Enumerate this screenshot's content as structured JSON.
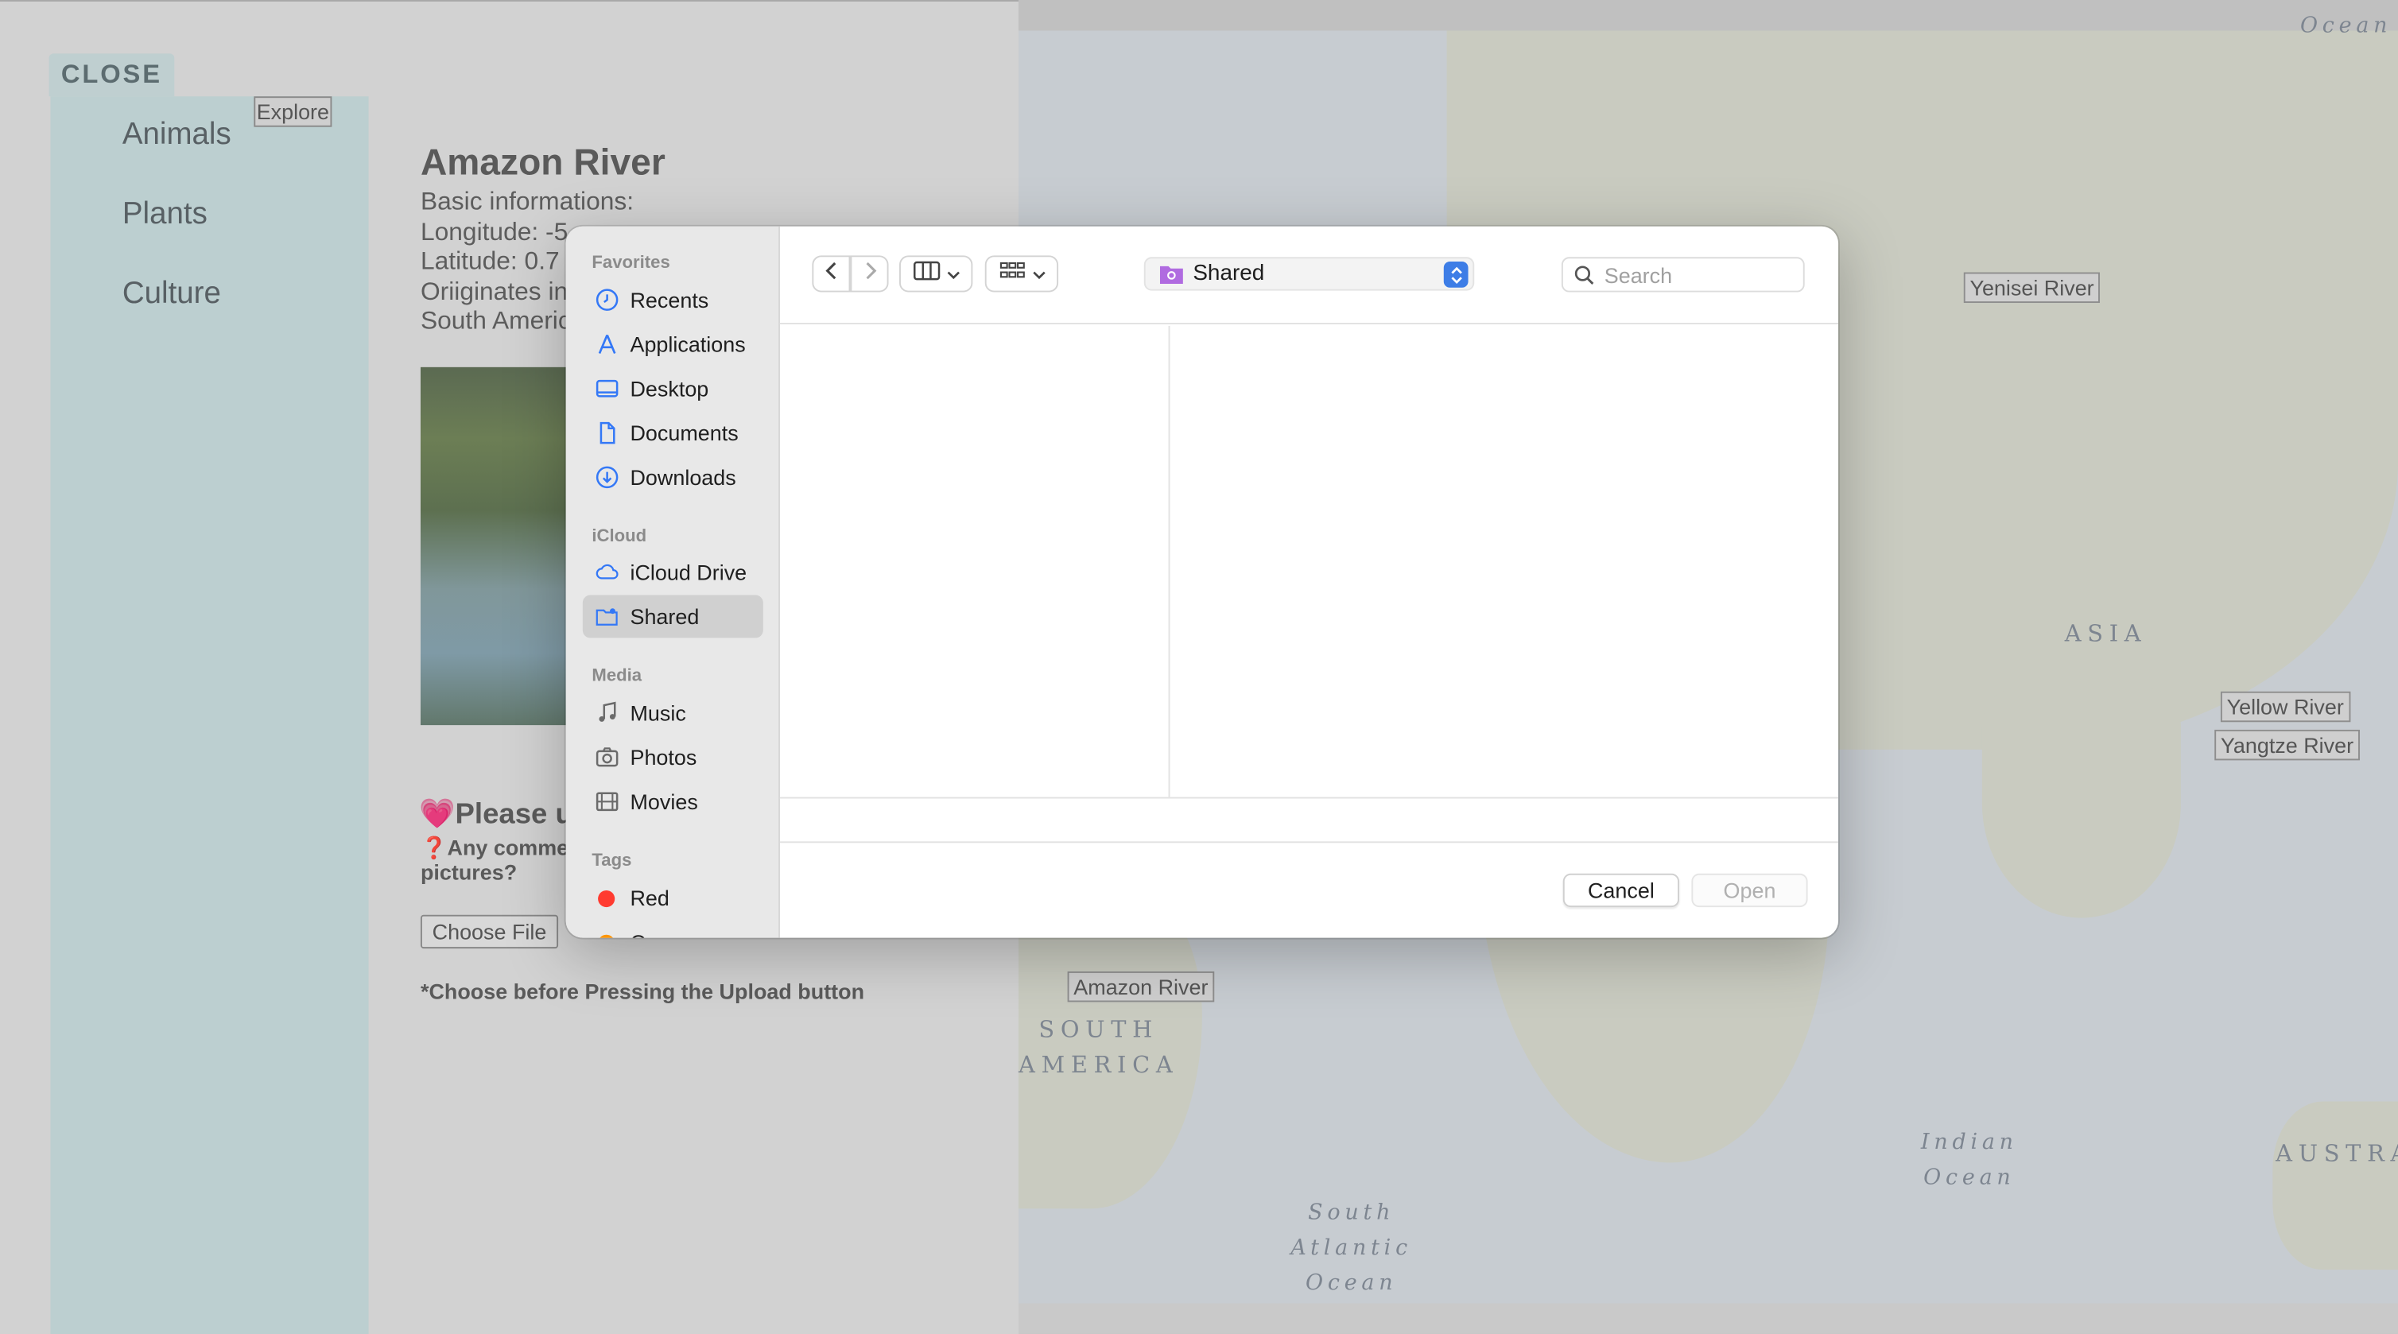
{
  "left_panel": {
    "close_label": "CLOSE",
    "explore_label": "Explore",
    "sidebar_links": [
      "Animals",
      "Plants",
      "Culture"
    ],
    "title": "Amazon River",
    "info_lines": [
      "Basic informations:",
      "Longitude: -5",
      "Latitude: 0.7",
      "Oriiginates in",
      "South Americ"
    ],
    "please_upload": "💗Please u",
    "comment_question": "❓Any commen pictures?",
    "choose_file_label": "Choose File",
    "choose_note": "*Choose before Pressing the Upload button"
  },
  "map": {
    "river_labels": {
      "yenisei": "Yenisei River",
      "yellow": "Yellow River",
      "yangtze": "Yangtze River",
      "amazon": "Amazon River"
    },
    "geo_labels": {
      "asia": "ASIA",
      "south_america": "SOUTH\nAMERICA",
      "indian_ocean": "Indian\nOcean",
      "south_atlantic": "South\nAtlantic\nOcean",
      "australia": "AUSTRA",
      "ocean_top": "Ocean"
    }
  },
  "dialog": {
    "sidebar": {
      "favorites_header": "Favorites",
      "favorites": [
        {
          "label": "Recents",
          "icon": "clock-icon"
        },
        {
          "label": "Applications",
          "icon": "applications-icon"
        },
        {
          "label": "Desktop",
          "icon": "desktop-icon"
        },
        {
          "label": "Documents",
          "icon": "document-icon"
        },
        {
          "label": "Downloads",
          "icon": "download-icon"
        }
      ],
      "icloud_header": "iCloud",
      "icloud": [
        {
          "label": "iCloud Drive",
          "icon": "cloud-icon"
        },
        {
          "label": "Shared",
          "icon": "shared-folder-icon",
          "selected": true
        }
      ],
      "media_header": "Media",
      "media": [
        {
          "label": "Music",
          "icon": "music-icon"
        },
        {
          "label": "Photos",
          "icon": "camera-icon"
        },
        {
          "label": "Movies",
          "icon": "film-icon"
        }
      ],
      "tags_header": "Tags",
      "tags": [
        {
          "label": "Red",
          "color": "#ff3b30"
        },
        {
          "label": "O",
          "color": "#ff9500"
        }
      ]
    },
    "toolbar": {
      "location": "Shared",
      "search_placeholder": "Search"
    },
    "buttons": {
      "cancel": "Cancel",
      "open": "Open"
    },
    "accent_color": "#3d7de6"
  }
}
